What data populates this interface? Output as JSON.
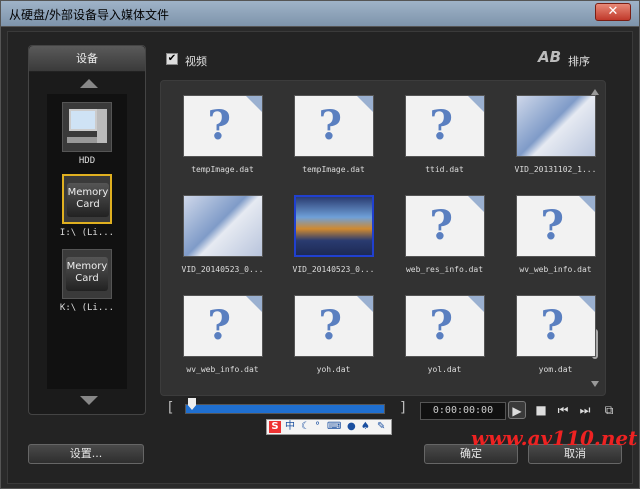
{
  "window": {
    "title": "从硬盘/外部设备导入媒体文件",
    "close_label": "✕"
  },
  "devices": {
    "header": "设备",
    "items": [
      {
        "name": "HDD",
        "label": "HDD",
        "icon": "computer-icon"
      },
      {
        "name": "memory-card-1",
        "label": "I:\\ (Li...",
        "card_text": "Memory Card",
        "icon": "memory-card-icon"
      },
      {
        "name": "memory-card-2",
        "label": "K:\\ (Li...",
        "card_text": "Memory Card",
        "icon": "memory-card-icon"
      }
    ]
  },
  "options": {
    "video_checkbox_label": "视频",
    "video_checked": "✔",
    "sort_icon_text": "AB",
    "sort_label": "排序"
  },
  "files": [
    {
      "label": "tempImage.dat",
      "kind": "unknown"
    },
    {
      "label": "tempImage.dat",
      "kind": "unknown"
    },
    {
      "label": "ttid.dat",
      "kind": "unknown"
    },
    {
      "label": "VID_20131102_1...",
      "kind": "video"
    },
    {
      "label": "VID_20140523_0...",
      "kind": "video"
    },
    {
      "label": "VID_20140523_0...",
      "kind": "photo"
    },
    {
      "label": "web_res_info.dat",
      "kind": "unknown"
    },
    {
      "label": "wv_web_info.dat",
      "kind": "unknown"
    },
    {
      "label": "wv_web_info.dat",
      "kind": "unknown"
    },
    {
      "label": "yoh.dat",
      "kind": "unknown"
    },
    {
      "label": "yol.dat",
      "kind": "unknown"
    },
    {
      "label": "yom.dat",
      "kind": "unknown"
    }
  ],
  "timeline": {
    "bracket_left": "[",
    "bracket_right": "]",
    "timecode": "0:00:00:00"
  },
  "ime": {
    "logo": "S",
    "mode": "中"
  },
  "buttons": {
    "settings": "设置...",
    "ok": "确定",
    "cancel": "取消"
  },
  "watermark": "www.av110.net",
  "colors": {
    "accent": "#1f6fd0",
    "selected_device": "#e0b020",
    "selected_file": "#2040d0"
  }
}
